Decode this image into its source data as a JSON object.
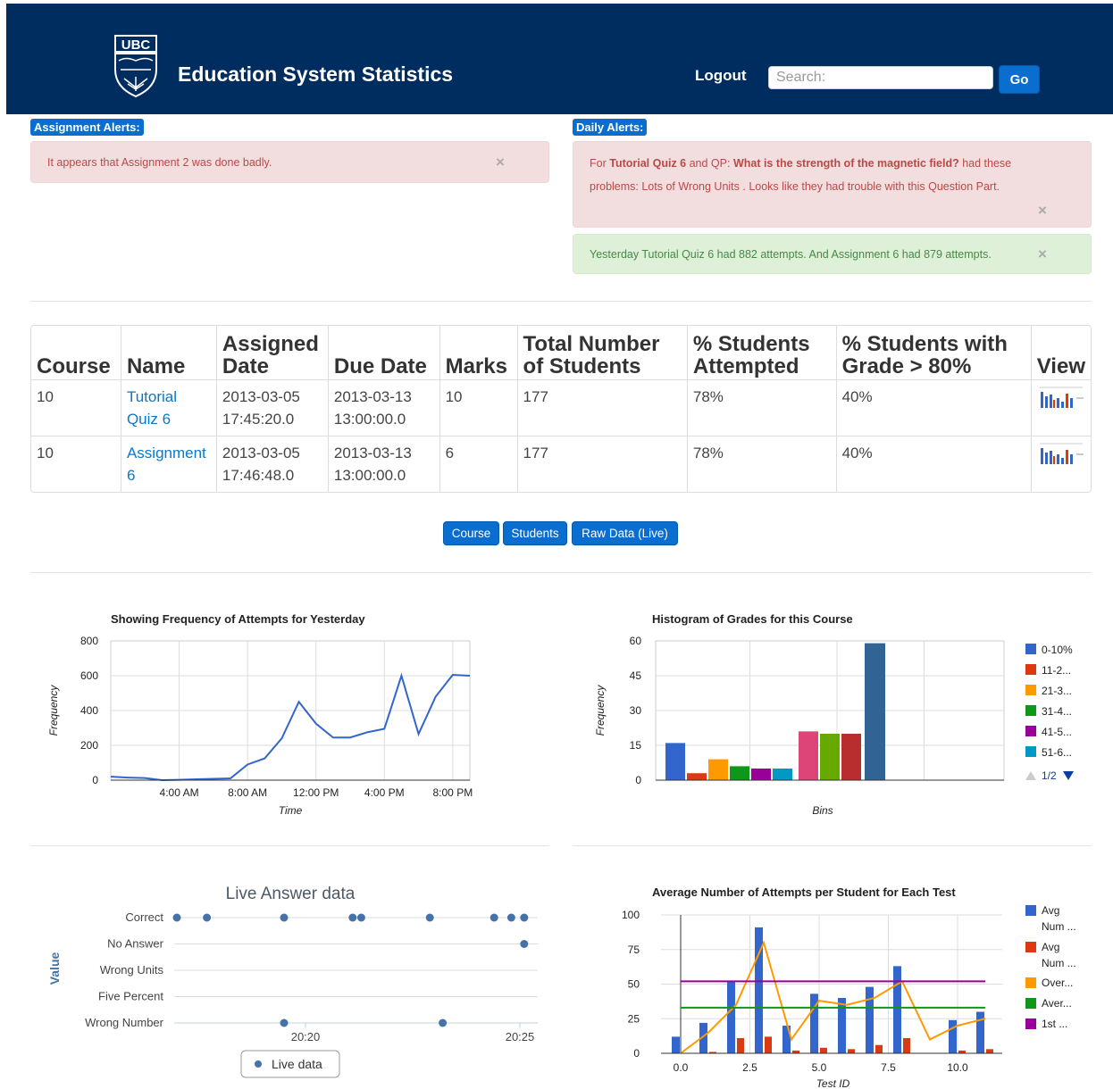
{
  "header": {
    "logo_text": "UBC",
    "title": "Education System Statistics",
    "logout": "Logout",
    "search_placeholder": "Search:",
    "go": "Go"
  },
  "assignment_alerts": {
    "label": "Assignment Alerts:",
    "message": "It appears that Assignment 2 was done badly."
  },
  "daily_alerts": {
    "label": "Daily Alerts:",
    "problem": {
      "prefix": "For ",
      "quiz": "Tutorial Quiz 6",
      "mid": " and QP: ",
      "question": "What is the strength of the magnetic field?",
      "suffix": " had these problems: Lots of Wrong Units . Looks like they had trouble with this Question Part."
    },
    "summary": "Yesterday Tutorial Quiz 6 had 882 attempts. And Assignment 6 had 879 attempts."
  },
  "table": {
    "headers": [
      "Course",
      "Name",
      "Assigned Date",
      "Due Date",
      "Marks",
      "Total Number of Students",
      "% Students Attempted",
      "% Students with Grade > 80%",
      "View"
    ],
    "rows": [
      {
        "course": "10",
        "name": "Tutorial Quiz 6",
        "assigned": "2013-03-05 17:45:20.0",
        "due": "2013-03-13 13:00:00.0",
        "marks": "10",
        "total": "177",
        "attempted": "78%",
        "grade80": "40%"
      },
      {
        "course": "10",
        "name": "Assignment 6",
        "assigned": "2013-03-05 17:46:48.0",
        "due": "2013-03-13 13:00:00.0",
        "marks": "6",
        "total": "177",
        "attempted": "78%",
        "grade80": "40%"
      }
    ]
  },
  "buttons": {
    "course": "Course",
    "students": "Students",
    "raw": "Raw Data (Live)"
  },
  "chart_data": [
    {
      "type": "line",
      "title": "Showing Frequency of Attempts for Yesterday",
      "xlabel": "Time",
      "ylabel": "Frequency",
      "ylim": [
        0,
        800
      ],
      "yticks": [
        "800",
        "600",
        "400",
        "200",
        "0"
      ],
      "xticks": [
        "4:00 AM",
        "8:00 AM",
        "12:00 PM",
        "4:00 PM",
        "8:00 PM"
      ],
      "x_hours": [
        0,
        1,
        2,
        3,
        4,
        5,
        6,
        7,
        8,
        9,
        10,
        11,
        12,
        13,
        14,
        15,
        16,
        17,
        18,
        19,
        20,
        21,
        22,
        23
      ],
      "values": [
        20,
        15,
        12,
        0,
        2,
        5,
        8,
        10,
        90,
        125,
        240,
        450,
        325,
        245,
        245,
        275,
        295,
        600,
        265,
        480,
        605,
        600
      ],
      "color": "#3366cc"
    },
    {
      "type": "bar",
      "title": "Histogram of Grades for this Course",
      "xlabel": "Bins",
      "ylabel": "Frequency",
      "ylim": [
        0,
        60
      ],
      "yticks": [
        "60",
        "45",
        "30",
        "15",
        "0"
      ],
      "values": [
        16,
        3,
        9,
        6,
        5,
        5,
        21,
        20,
        20,
        59
      ],
      "colors": [
        "#3366cc",
        "#dc3912",
        "#ff9900",
        "#109618",
        "#990099",
        "#0099c6",
        "#dd4477",
        "#66aa00",
        "#b82e2e",
        "#316395"
      ],
      "legend": [
        "0-10%",
        "11-2...",
        "21-3...",
        "31-4...",
        "41-5...",
        "51-6..."
      ],
      "legend_page": "1/2",
      "legend_position": "right"
    },
    {
      "type": "scatter",
      "title": "Live Answer data",
      "ylabel": "Value",
      "categories": [
        "Correct",
        "No Answer",
        "Wrong Units",
        "Five Percent",
        "Wrong Number"
      ],
      "xticks": [
        "20:20",
        "20:25"
      ],
      "points": [
        {
          "t": "20:17.0",
          "cat": "Correct"
        },
        {
          "t": "20:17.7",
          "cat": "Correct"
        },
        {
          "t": "20:19.5",
          "cat": "Correct"
        },
        {
          "t": "20:21.1",
          "cat": "Correct"
        },
        {
          "t": "20:21.3",
          "cat": "Correct"
        },
        {
          "t": "20:22.9",
          "cat": "Correct"
        },
        {
          "t": "20:24.4",
          "cat": "Correct"
        },
        {
          "t": "20:24.8",
          "cat": "Correct"
        },
        {
          "t": "20:25.1",
          "cat": "Correct"
        },
        {
          "t": "20:25.1",
          "cat": "No Answer"
        },
        {
          "t": "20:19.5",
          "cat": "Wrong Number"
        },
        {
          "t": "20:23.2",
          "cat": "Wrong Number"
        }
      ],
      "legend": [
        "Live data"
      ],
      "color": "#4572a7"
    },
    {
      "type": "bar",
      "title": "Average Number of Attempts per Student for Each Test",
      "xlabel": "Test ID",
      "ylim": [
        0,
        100
      ],
      "yticks": [
        "100",
        "75",
        "50",
        "25",
        "0"
      ],
      "xticks": [
        "0.0",
        "2.5",
        "5.0",
        "7.5",
        "10.0"
      ],
      "test_ids": [
        0,
        1,
        2,
        3,
        4,
        5,
        6,
        7,
        8,
        9,
        10,
        11
      ],
      "series": [
        {
          "name": "Avg Num ...",
          "color": "#3366cc",
          "values": [
            12,
            22,
            52,
            91,
            20,
            43,
            40,
            48,
            63,
            0,
            24,
            30
          ]
        },
        {
          "name": "Avg Num ...",
          "color": "#dc3912",
          "values": [
            0,
            1,
            11,
            12,
            2,
            4,
            3,
            6,
            11,
            0,
            2,
            3
          ]
        },
        {
          "name": "Over...",
          "color": "#ff9900",
          "type": "line",
          "values": [
            0,
            15,
            35,
            80,
            10,
            38,
            35,
            40,
            52,
            10,
            20,
            25
          ]
        },
        {
          "name": "Aver...",
          "color": "#109618",
          "type": "line",
          "constant": 33
        },
        {
          "name": "1st ...",
          "color": "#990099",
          "type": "line",
          "constant": 52
        }
      ],
      "legend_position": "right"
    }
  ]
}
